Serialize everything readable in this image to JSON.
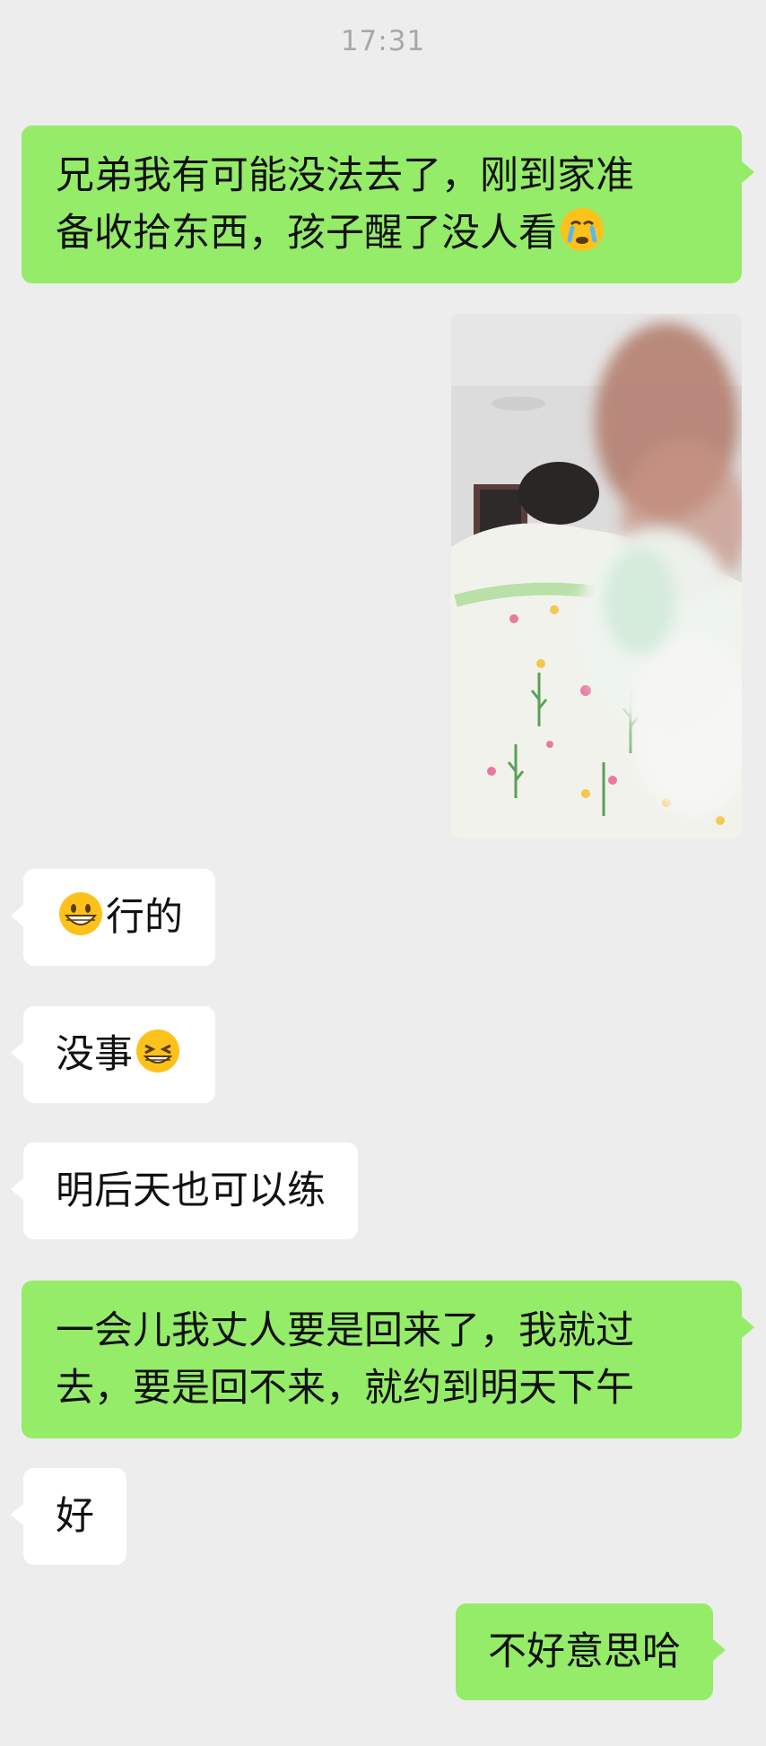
{
  "chat": {
    "timestamp": "17:31",
    "messages": [
      {
        "sender": "me",
        "lines": [
          "兄弟我有可能没法去了，刚到家准",
          "备收拾东西，孩子醒了没人看"
        ],
        "emoji_after": "crying-face-icon"
      },
      {
        "sender": "me",
        "type": "image"
      },
      {
        "sender": "other",
        "emoji_before": "grinning-face-icon",
        "text": "行的"
      },
      {
        "sender": "other",
        "text": "没事",
        "emoji_after": "grin-squint-icon"
      },
      {
        "sender": "other",
        "text": "明后天也可以练"
      },
      {
        "sender": "me",
        "lines": [
          "一会儿我丈人要是回来了，我就过",
          "去，要是回不来，就约到明天下午"
        ]
      },
      {
        "sender": "other",
        "text": "好"
      },
      {
        "sender": "me",
        "text": "不好意思哈"
      }
    ]
  },
  "colors": {
    "background": "#ededed",
    "my_bubble": "#95ec69",
    "their_bubble": "#ffffff",
    "timestamp": "#a8a8a8"
  }
}
